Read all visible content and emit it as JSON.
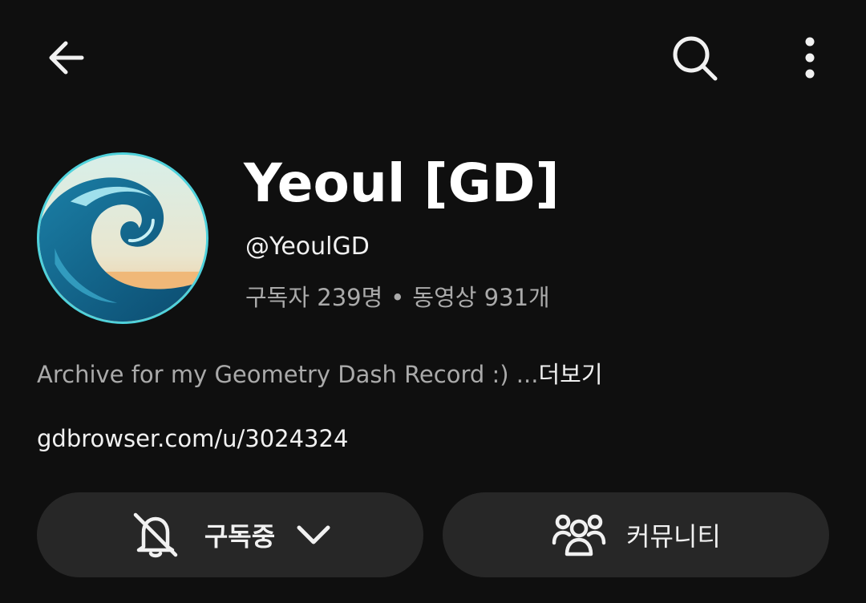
{
  "header": {
    "back_icon": "arrow-left-icon",
    "search_icon": "search-icon",
    "more_icon": "more-vertical-icon"
  },
  "channel": {
    "name": "Yeoul [GD]",
    "handle": "@YeoulGD",
    "subscribers": "구독자 239명",
    "separator": "•",
    "videos": "동영상 931개",
    "avatar_icon": "wave-avatar",
    "description": "Archive for my Geometry Dash Record :) ...",
    "more_label": "더보기",
    "link": "gdbrowser.com/u/3024324"
  },
  "actions": {
    "subscribe_label": "구독중",
    "subscribe_icon": "bell-off-icon",
    "subscribe_dropdown_icon": "chevron-down-icon",
    "community_label": "커뮤니티",
    "community_icon": "people-icon"
  },
  "colors": {
    "background": "#0f0f0f",
    "pill": "#272727",
    "secondary_text": "#aaaaaa",
    "avatar_border": "#4fd2dc"
  }
}
